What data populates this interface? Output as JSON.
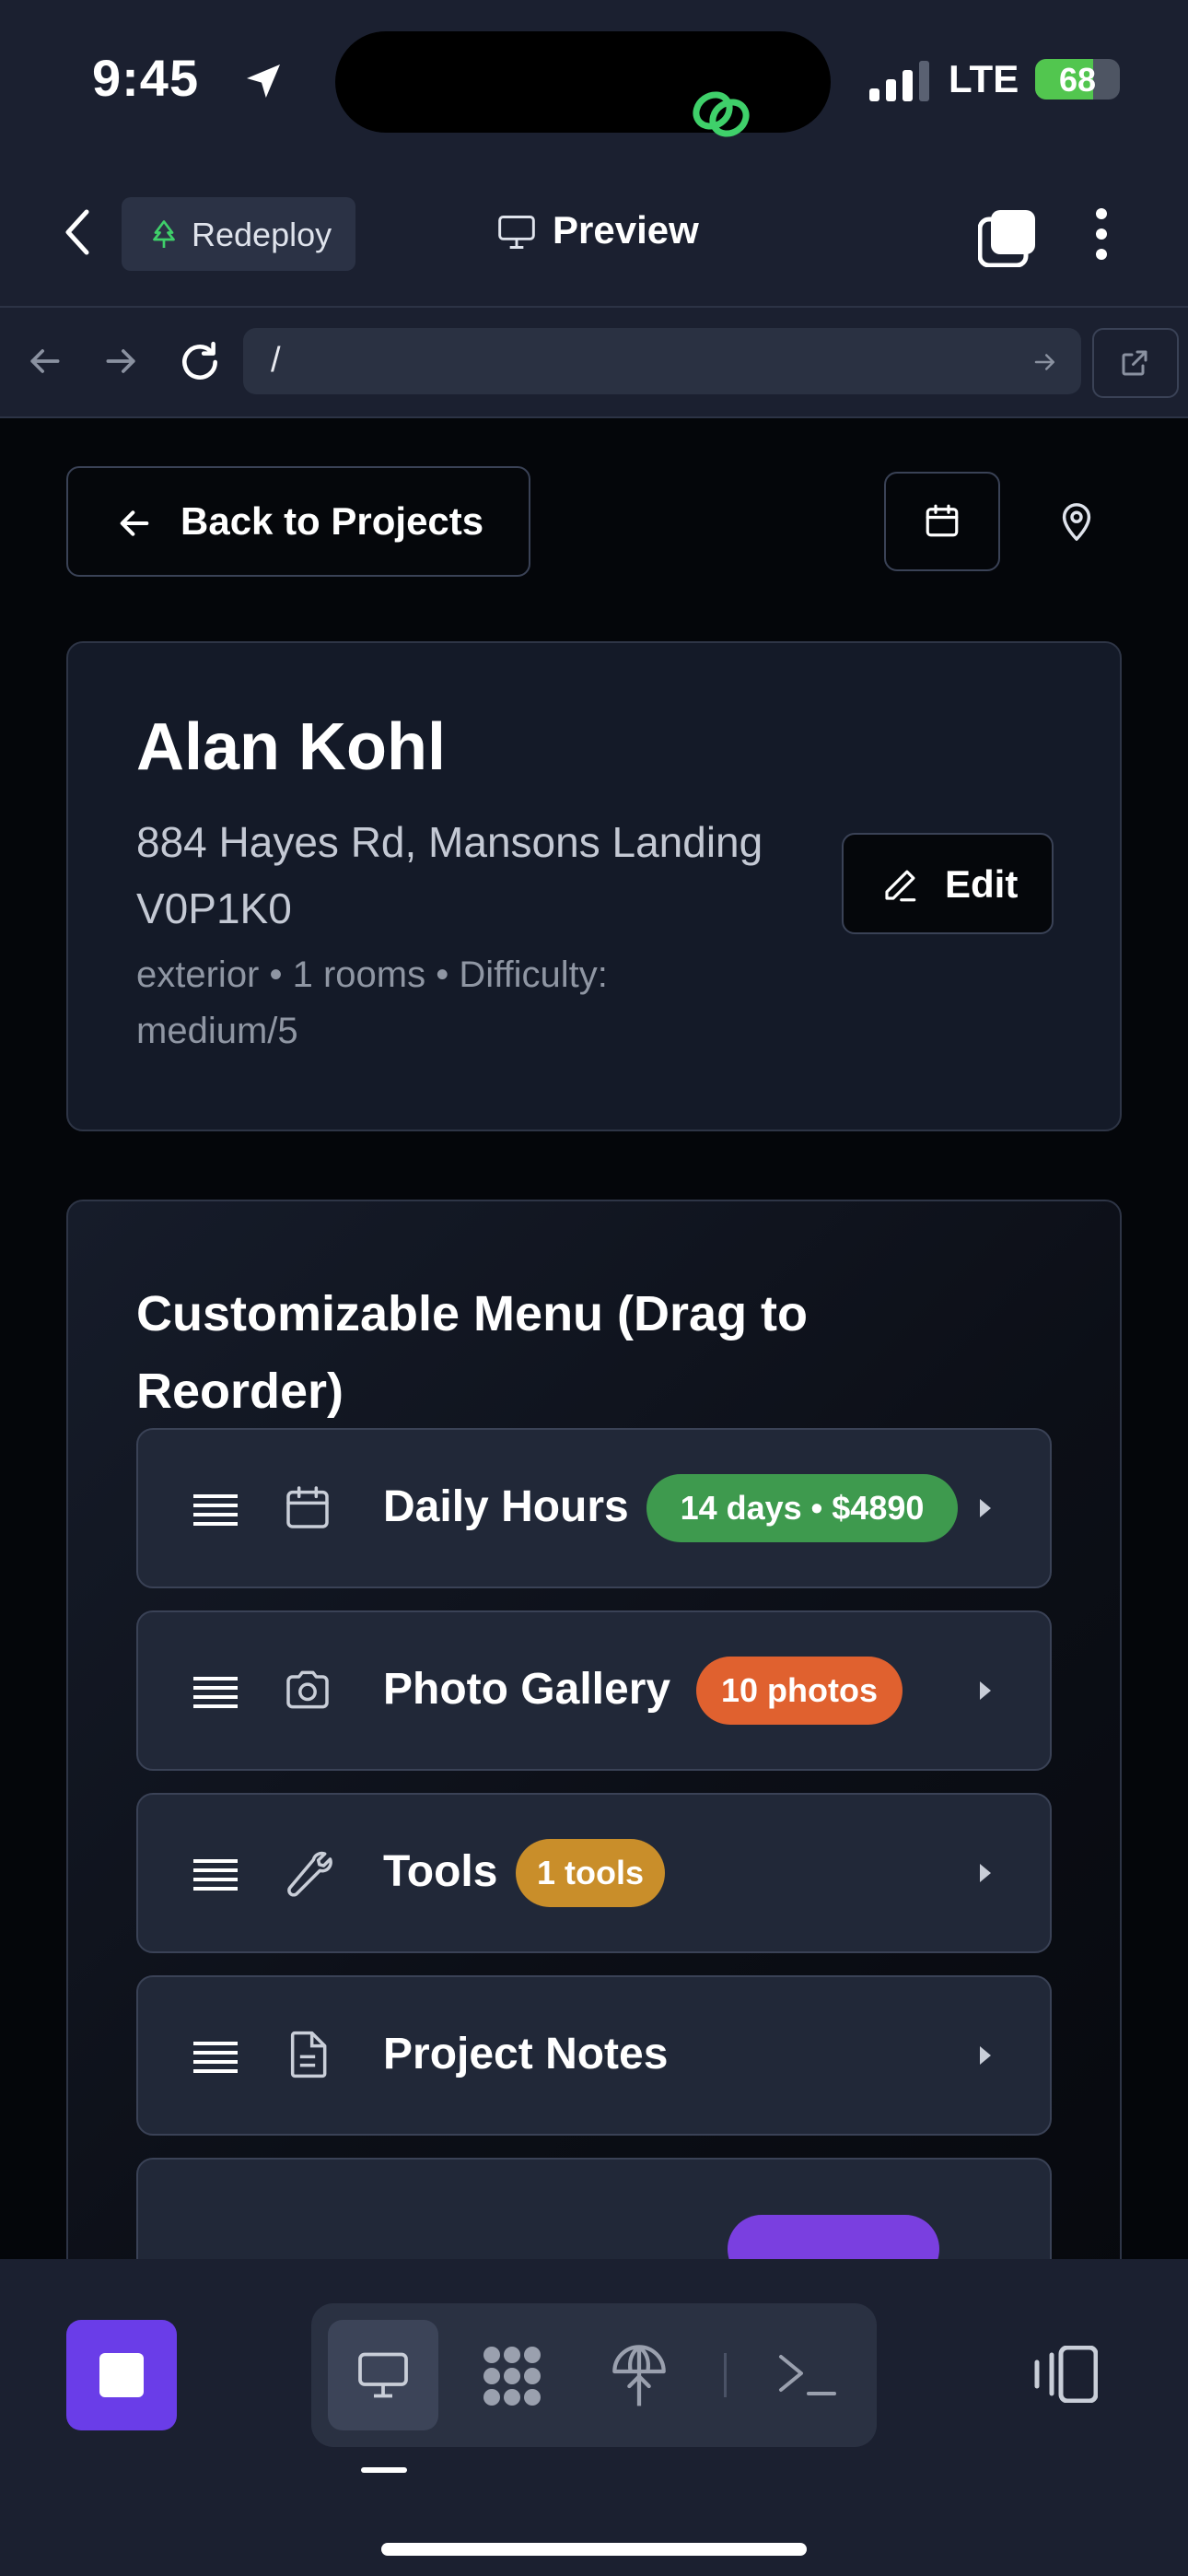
{
  "status_bar": {
    "time": "9:45",
    "network": "LTE",
    "battery_level": 68,
    "battery_text": "68"
  },
  "header": {
    "redeploy_label": "Redeploy",
    "preview_label": "Preview"
  },
  "url_bar": {
    "url": "/"
  },
  "page": {
    "back_label": "Back to Projects",
    "client": {
      "name": "Alan Kohl",
      "address_line1": "884 Hayes Rd, Mansons Landing",
      "address_line2": "V0P1K0",
      "meta_line1": "exterior • 1 rooms • Difficulty:",
      "meta_line2": "medium/5",
      "edit_label": "Edit"
    },
    "menu": {
      "title": "Customizable Menu (Drag to Reorder)",
      "items": [
        {
          "label": "Daily Hours",
          "badge": "14 days • $4890",
          "badge_color": "#3e9a4e",
          "icon": "calendar-icon"
        },
        {
          "label": "Photo Gallery",
          "badge": "10 photos",
          "badge_color": "#e0612f",
          "icon": "camera-icon"
        },
        {
          "label": "Tools",
          "badge": "1 tools",
          "badge_color": "#c98e2a",
          "icon": "wrench-icon"
        },
        {
          "label": "Project Notes",
          "badge": "",
          "badge_color": "",
          "icon": "document-icon"
        },
        {
          "label": "",
          "badge": "",
          "badge_color": "#7a3fe0",
          "icon": ""
        }
      ]
    }
  },
  "colors": {
    "accent_purple": "#6a3de8",
    "badge_green": "#3e9a4e",
    "badge_orange": "#e0612f",
    "badge_amber": "#c98e2a",
    "surface": "#1b2030"
  }
}
